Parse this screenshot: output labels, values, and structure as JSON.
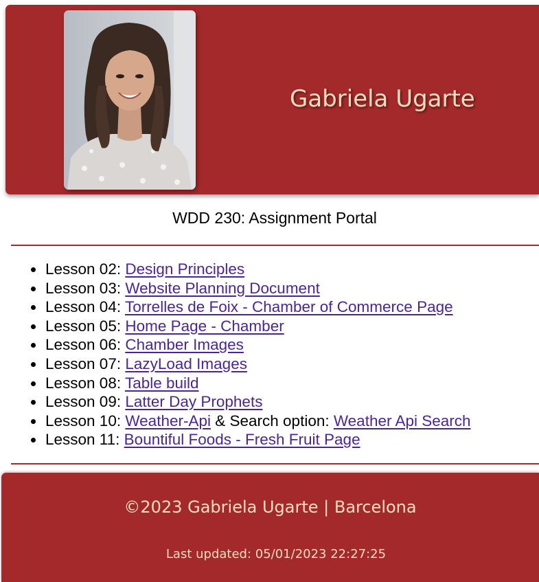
{
  "header": {
    "name": "Gabriela Ugarte",
    "photo_alt": "portrait photo"
  },
  "subtitle": "WDD 230: Assignment Portal",
  "lessons": [
    {
      "prefix": "Lesson 02: ",
      "link": "Design Principles"
    },
    {
      "prefix": "Lesson 03: ",
      "link": "Website Planning Document"
    },
    {
      "prefix": "Lesson 04: ",
      "link": "Torrelles de Foix - Chamber of Commerce Page"
    },
    {
      "prefix": "Lesson 05: ",
      "link": "Home Page - Chamber"
    },
    {
      "prefix": "Lesson 06: ",
      "link": "Chamber Images"
    },
    {
      "prefix": "Lesson 07: ",
      "link": "LazyLoad Images"
    },
    {
      "prefix": "Lesson 08: ",
      "link": "Table build"
    },
    {
      "prefix": "Lesson 09: ",
      "link": "Latter Day Prophets"
    },
    {
      "prefix": "Lesson 10: ",
      "link": "Weather-Api",
      "middle": " & Search option: ",
      "link2": "Weather Api Search"
    },
    {
      "prefix": "Lesson 11: ",
      "link": "Bountiful Foods - Fresh Fruit Page"
    }
  ],
  "footer": {
    "copyright": "©2023 Gabriela Ugarte | Barcelona",
    "last_updated": "Last updated: 05/01/2023 22:27:25"
  },
  "colors": {
    "accent": "#a3292a",
    "header_text": "#f8dcc0",
    "link": "#4b2596"
  }
}
